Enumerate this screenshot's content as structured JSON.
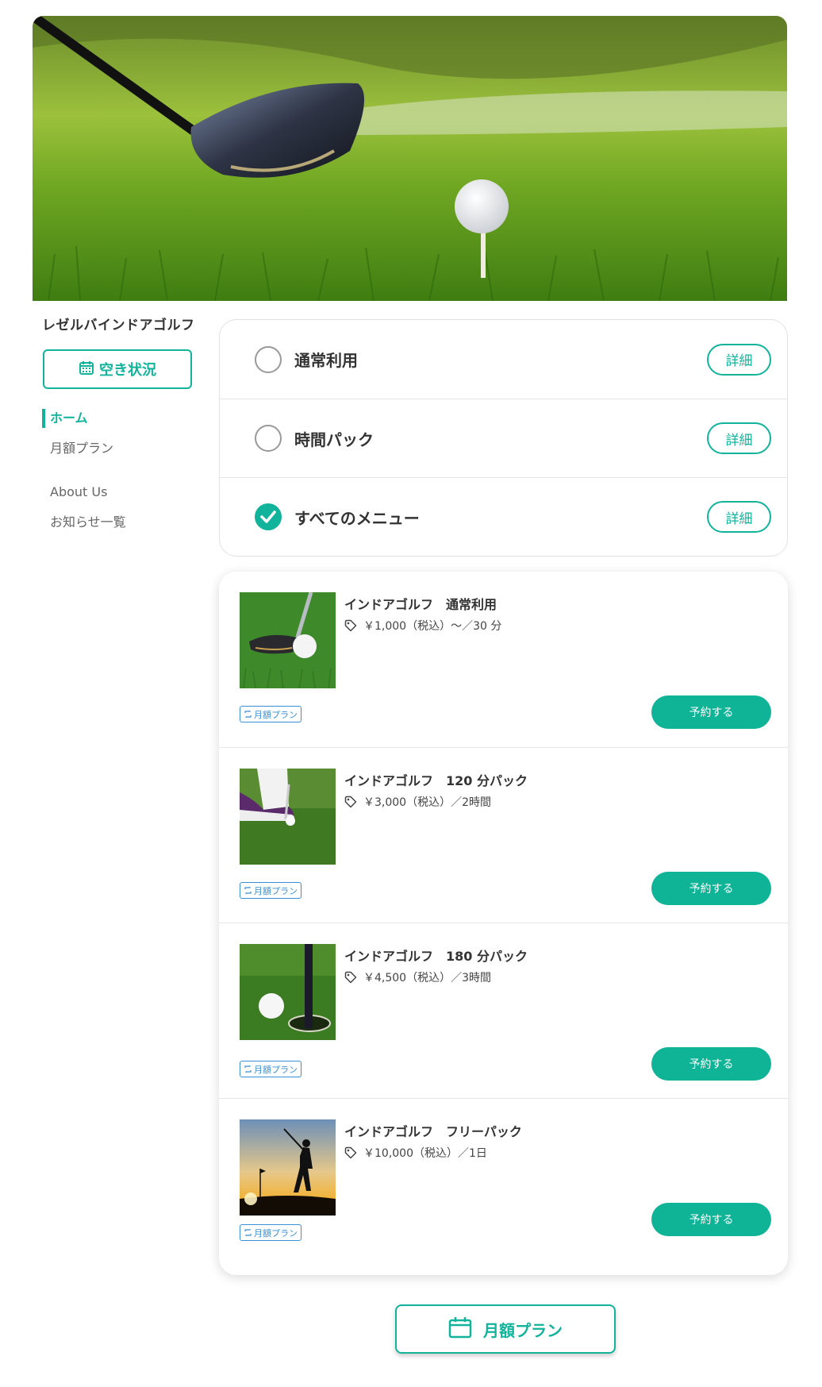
{
  "hero": {
    "image": "golf-driver-ball-on-tee-photo"
  },
  "sidebar": {
    "shop_name": "レゼルバインドアゴルフ",
    "availability_label": "空き状況",
    "nav": [
      {
        "label": "ホーム",
        "active": true
      },
      {
        "label": "月額プラン",
        "active": false
      },
      {
        "label": "About Us",
        "active": false
      },
      {
        "label": "お知らせ一覧",
        "active": false
      }
    ]
  },
  "categories": [
    {
      "label": "通常利用",
      "checked": false,
      "detail_label": "詳細"
    },
    {
      "label": "時間パック",
      "checked": false,
      "detail_label": "詳細"
    },
    {
      "label": "すべてのメニュー",
      "checked": true,
      "detail_label": "詳細"
    }
  ],
  "menu_items": [
    {
      "title": "インドアゴルフ　通常利用",
      "price": "￥1,000（税込）〜／30 分",
      "badge": "月額プラン",
      "reserve_label": "予約する",
      "image": "golf-club-and-ball-photo"
    },
    {
      "title": "インドアゴルフ　120 分パック",
      "price": "￥3,000（税込）／2時間",
      "badge": "月額プラン",
      "reserve_label": "予約する",
      "image": "golfer-shoes-putting-photo"
    },
    {
      "title": "インドアゴルフ　180 分パック",
      "price": "￥4,500（税込）／3時間",
      "badge": "月額プラン",
      "reserve_label": "予約する",
      "image": "ball-near-hole-flagstick-photo"
    },
    {
      "title": "インドアゴルフ　フリーパック",
      "price": "￥10,000（税込）／1日",
      "badge": "月額プラン",
      "reserve_label": "予約する",
      "image": "golfer-silhouette-sunset-photo"
    }
  ],
  "bottom_button": {
    "label": "月額プラン"
  },
  "colors": {
    "accent": "#11b49a",
    "reserve": "#0fb395",
    "badge": "#3a8fd6"
  }
}
